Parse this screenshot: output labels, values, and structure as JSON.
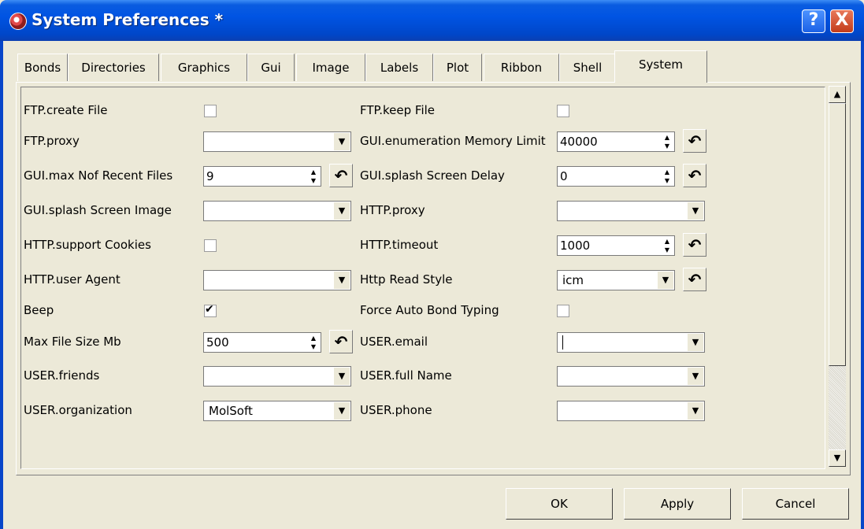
{
  "window": {
    "title": "System Preferences *"
  },
  "tabs": [
    "Bonds",
    "Directories",
    "Graphics",
    "Gui",
    "Image",
    "Labels",
    "Plot",
    "Ribbon",
    "Shell",
    "System"
  ],
  "active_tab": "System",
  "fields": {
    "ftp_create_file": {
      "label": "FTP.create File",
      "checked": false
    },
    "ftp_keep_file": {
      "label": "FTP.keep File",
      "checked": false
    },
    "ftp_proxy": {
      "label": "FTP.proxy",
      "value": ""
    },
    "gui_enum_mem": {
      "label": "GUI.enumeration Memory Limit",
      "value": "40000"
    },
    "gui_max_recent": {
      "label": "GUI.max Nof Recent Files",
      "value": "9"
    },
    "gui_splash_delay": {
      "label": "GUI.splash Screen Delay",
      "value": "0"
    },
    "gui_splash_image": {
      "label": "GUI.splash Screen Image",
      "value": ""
    },
    "http_proxy": {
      "label": "HTTP.proxy",
      "value": ""
    },
    "http_cookies": {
      "label": "HTTP.support Cookies",
      "checked": false
    },
    "http_timeout": {
      "label": "HTTP.timeout",
      "value": "1000"
    },
    "http_user_agent": {
      "label": "HTTP.user Agent",
      "value": ""
    },
    "http_read_style": {
      "label": "Http Read Style",
      "value": "icm"
    },
    "beep": {
      "label": "Beep",
      "checked": true
    },
    "force_auto_bond": {
      "label": "Force Auto Bond Typing",
      "checked": false
    },
    "max_file_size": {
      "label": "Max File Size Mb",
      "value": "500"
    },
    "user_email": {
      "label": "USER.email",
      "value": ""
    },
    "user_friends": {
      "label": "USER.friends",
      "value": ""
    },
    "user_full_name": {
      "label": "USER.full Name",
      "value": ""
    },
    "user_org": {
      "label": "USER.organization",
      "value": "MolSoft"
    },
    "user_phone": {
      "label": "USER.phone",
      "value": ""
    }
  },
  "buttons": {
    "ok": "OK",
    "apply": "Apply",
    "cancel": "Cancel"
  },
  "icons": {
    "help": "?",
    "close": "X",
    "reset": "↶",
    "dropdown": "▼",
    "spin": "▲▼",
    "scroll_up": "▲",
    "scroll_down": "▼"
  }
}
